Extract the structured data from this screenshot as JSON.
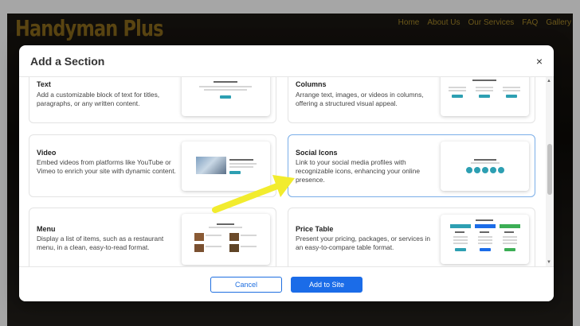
{
  "site": {
    "logo": "Handyman Plus",
    "nav": [
      "Home",
      "About Us",
      "Our Services",
      "FAQ",
      "Gallery"
    ]
  },
  "modal": {
    "title": "Add a Section",
    "close_icon": "×",
    "sections": [
      {
        "title": "Text",
        "description": "Add a customizable block of text for titles, paragraphs, or any written content."
      },
      {
        "title": "Columns",
        "description": "Arrange text, images, or videos in columns, offering a structured visual appeal."
      },
      {
        "title": "Video",
        "description": "Embed videos from platforms like YouTube or Vimeo to enrich your site with dynamic content."
      },
      {
        "title": "Social Icons",
        "description": "Link to your social media profiles with recognizable icons, enhancing your online presence."
      },
      {
        "title": "Menu",
        "description": "Display a list of items, such as a restaurant menu, in a clean, easy-to-read format."
      },
      {
        "title": "Price Table",
        "description": "Present your pricing, packages, or services in an easy-to-compare table format."
      }
    ],
    "selected_section": "Social Icons",
    "footer": {
      "cancel_label": "Cancel",
      "add_label": "Add to Site"
    }
  },
  "colors": {
    "accent": "#1b6ce8",
    "thumb_button": "#2d9fb2",
    "highlight_arrow": "#f2ec2e"
  },
  "icons": [
    "close-icon",
    "arrow-annotation-icon",
    "social-circle-icon"
  ]
}
